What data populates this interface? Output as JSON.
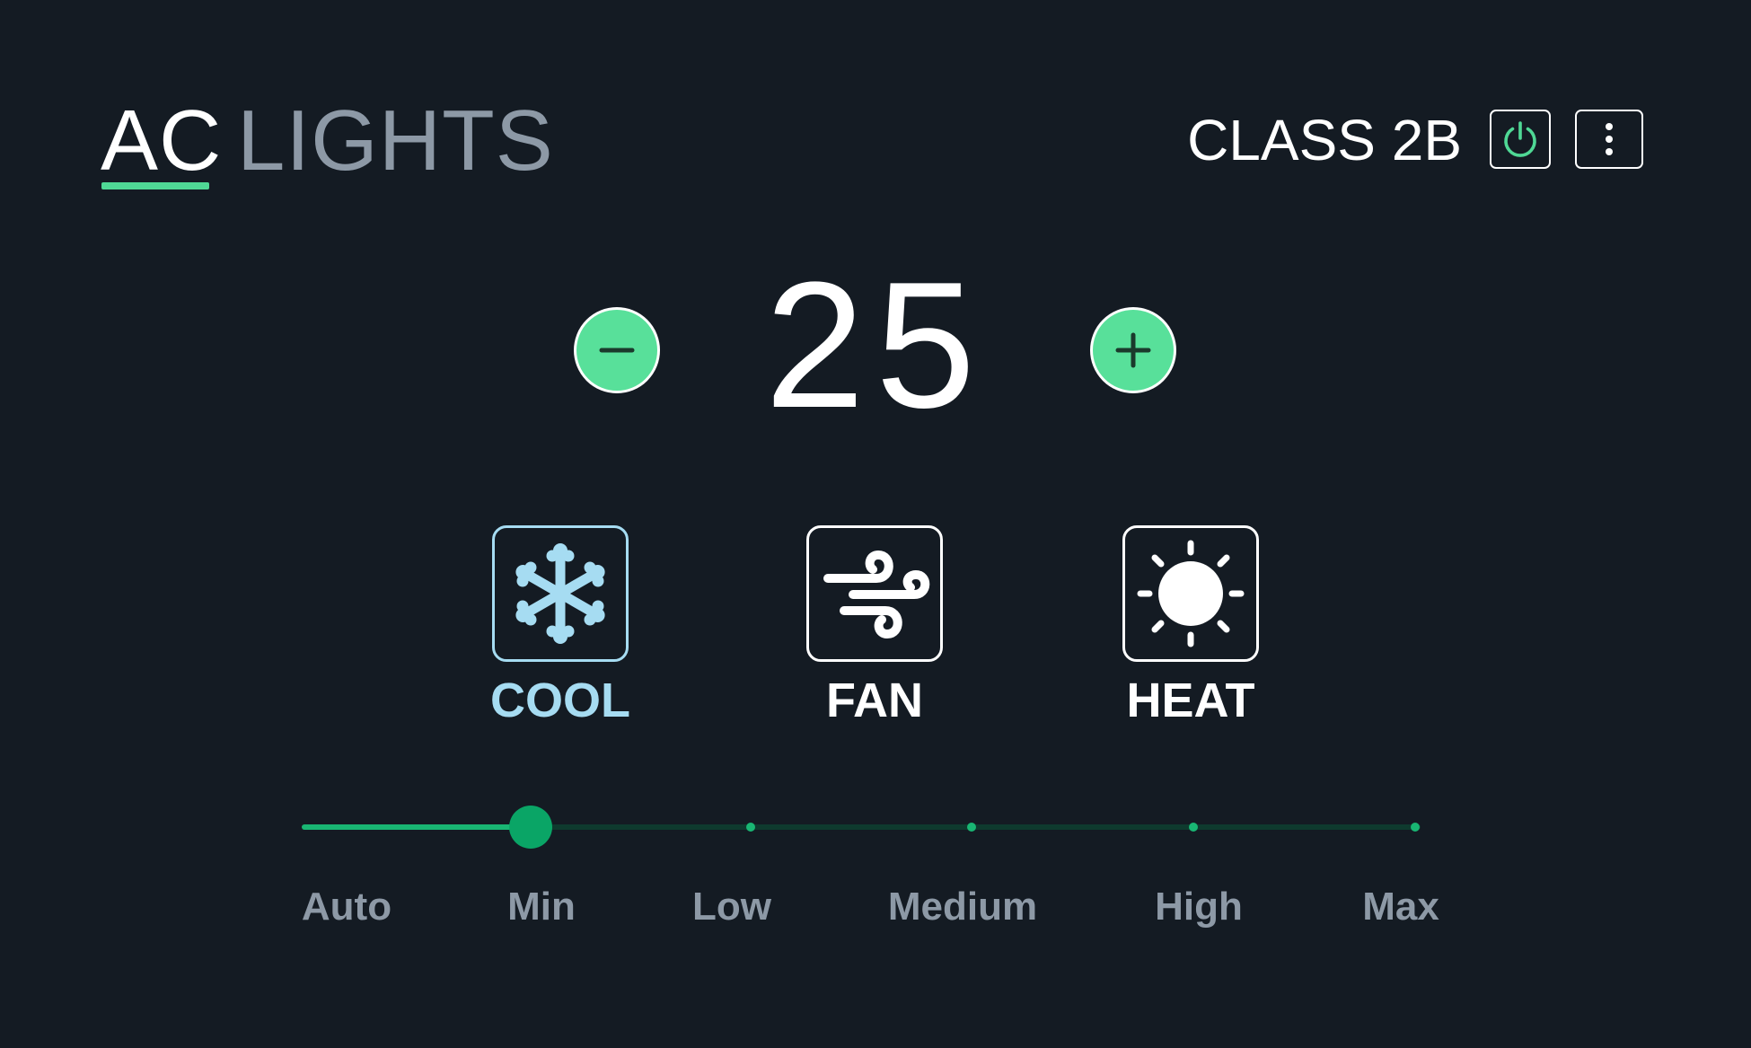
{
  "header": {
    "tabs": [
      {
        "label": "AC",
        "active": true
      },
      {
        "label": "LIGHTS",
        "active": false
      }
    ],
    "room_name": "CLASS 2B",
    "power_icon": "power-icon",
    "menu_icon": "more-vertical-icon"
  },
  "temperature": {
    "value": "25",
    "decrease_icon": "minus-icon",
    "increase_icon": "plus-icon"
  },
  "modes": [
    {
      "label": "COOL",
      "icon": "snowflake-icon",
      "selected": true
    },
    {
      "label": "FAN",
      "icon": "wind-icon",
      "selected": false
    },
    {
      "label": "HEAT",
      "icon": "sun-icon",
      "selected": false
    }
  ],
  "fan_speed": {
    "levels": [
      "Auto",
      "Min",
      "Low",
      "Medium",
      "High",
      "Max"
    ],
    "selected_index": 1,
    "selected": "Min"
  },
  "colors": {
    "background": "#141b23",
    "accent_green": "#58e09a",
    "slider_active": "#19b673",
    "slider_track": "#0e3a2e",
    "cool_blue": "#a6dcf2",
    "muted_text": "#8d99a6",
    "text": "#ffffff"
  }
}
